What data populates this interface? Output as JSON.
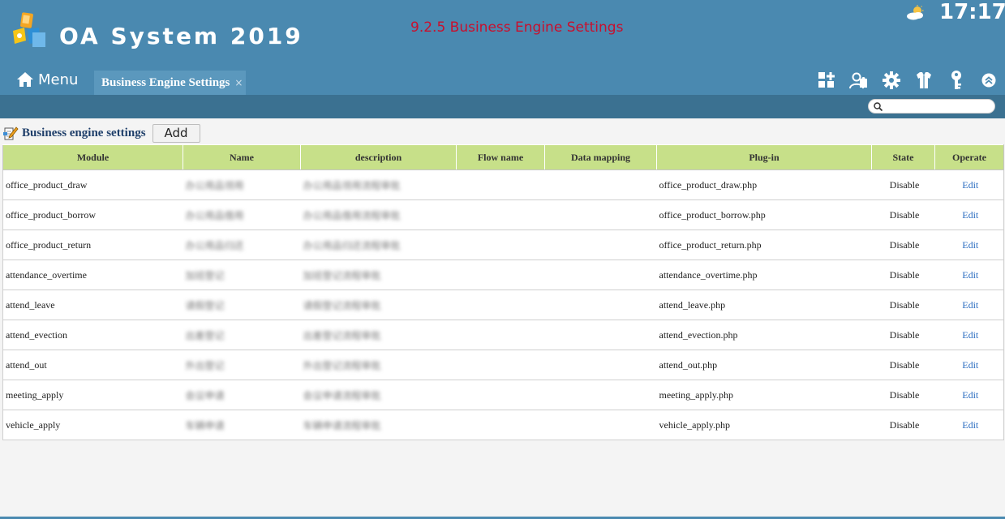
{
  "header": {
    "app_title": "OA System 2019",
    "doc_title": "9.2.5 Business Engine Settings",
    "clock": "17:17"
  },
  "nav": {
    "menu_label": "Menu",
    "tab_label": "Business Engine Settings",
    "tab_close": "×"
  },
  "search": {
    "placeholder": "",
    "value": ""
  },
  "section": {
    "title": "Business engine settings",
    "add_label": "Add"
  },
  "table": {
    "columns": [
      "Module",
      "Name",
      "description",
      "Flow name",
      "Data mapping",
      "Plug-in",
      "State",
      "Operate"
    ],
    "rows": [
      {
        "module": "office_product_draw",
        "name": "办公用品领用",
        "description": "办公用品领用流程审批",
        "flow": "",
        "mapping": "",
        "plugin": "office_product_draw.php",
        "state": "Disable",
        "op": "Edit"
      },
      {
        "module": "office_product_borrow",
        "name": "办公用品借用",
        "description": "办公用品借用流程审批",
        "flow": "",
        "mapping": "",
        "plugin": "office_product_borrow.php",
        "state": "Disable",
        "op": "Edit"
      },
      {
        "module": "office_product_return",
        "name": "办公用品归还",
        "description": "办公用品归还流程审批",
        "flow": "",
        "mapping": "",
        "plugin": "office_product_return.php",
        "state": "Disable",
        "op": "Edit"
      },
      {
        "module": "attendance_overtime",
        "name": "加班登记",
        "description": "加班登记流程审批",
        "flow": "",
        "mapping": "",
        "plugin": "attendance_overtime.php",
        "state": "Disable",
        "op": "Edit"
      },
      {
        "module": "attend_leave",
        "name": "请假登记",
        "description": "请假登记流程审批",
        "flow": "",
        "mapping": "",
        "plugin": "attend_leave.php",
        "state": "Disable",
        "op": "Edit"
      },
      {
        "module": "attend_evection",
        "name": "出差登记",
        "description": "出差登记流程审批",
        "flow": "",
        "mapping": "",
        "plugin": "attend_evection.php",
        "state": "Disable",
        "op": "Edit"
      },
      {
        "module": "attend_out",
        "name": "外出登记",
        "description": "外出登记流程审批",
        "flow": "",
        "mapping": "",
        "plugin": "attend_out.php",
        "state": "Disable",
        "op": "Edit"
      },
      {
        "module": "meeting_apply",
        "name": "会议申请",
        "description": "会议申请流程审批",
        "flow": "",
        "mapping": "",
        "plugin": "meeting_apply.php",
        "state": "Disable",
        "op": "Edit"
      },
      {
        "module": "vehicle_apply",
        "name": "车辆申请",
        "description": "车辆申请流程审批",
        "flow": "",
        "mapping": "",
        "plugin": "vehicle_apply.php",
        "state": "Disable",
        "op": "Edit"
      }
    ]
  },
  "icons": {
    "logo": "oa-logo-icon",
    "weather": "partly-cloudy-icon",
    "home": "home-icon",
    "tools": [
      "apps-add-icon",
      "user-puzzle-icon",
      "gear-icon",
      "shirt-icon",
      "key-icon",
      "chevron-up-icon"
    ],
    "search": "search-icon",
    "section": "document-edit-icon"
  },
  "colors": {
    "header_bg": "#4a89b0",
    "subbar_bg": "#3b7191",
    "table_header_bg": "#c7e089",
    "doc_title": "#c8102e",
    "link": "#2a6cc0"
  }
}
